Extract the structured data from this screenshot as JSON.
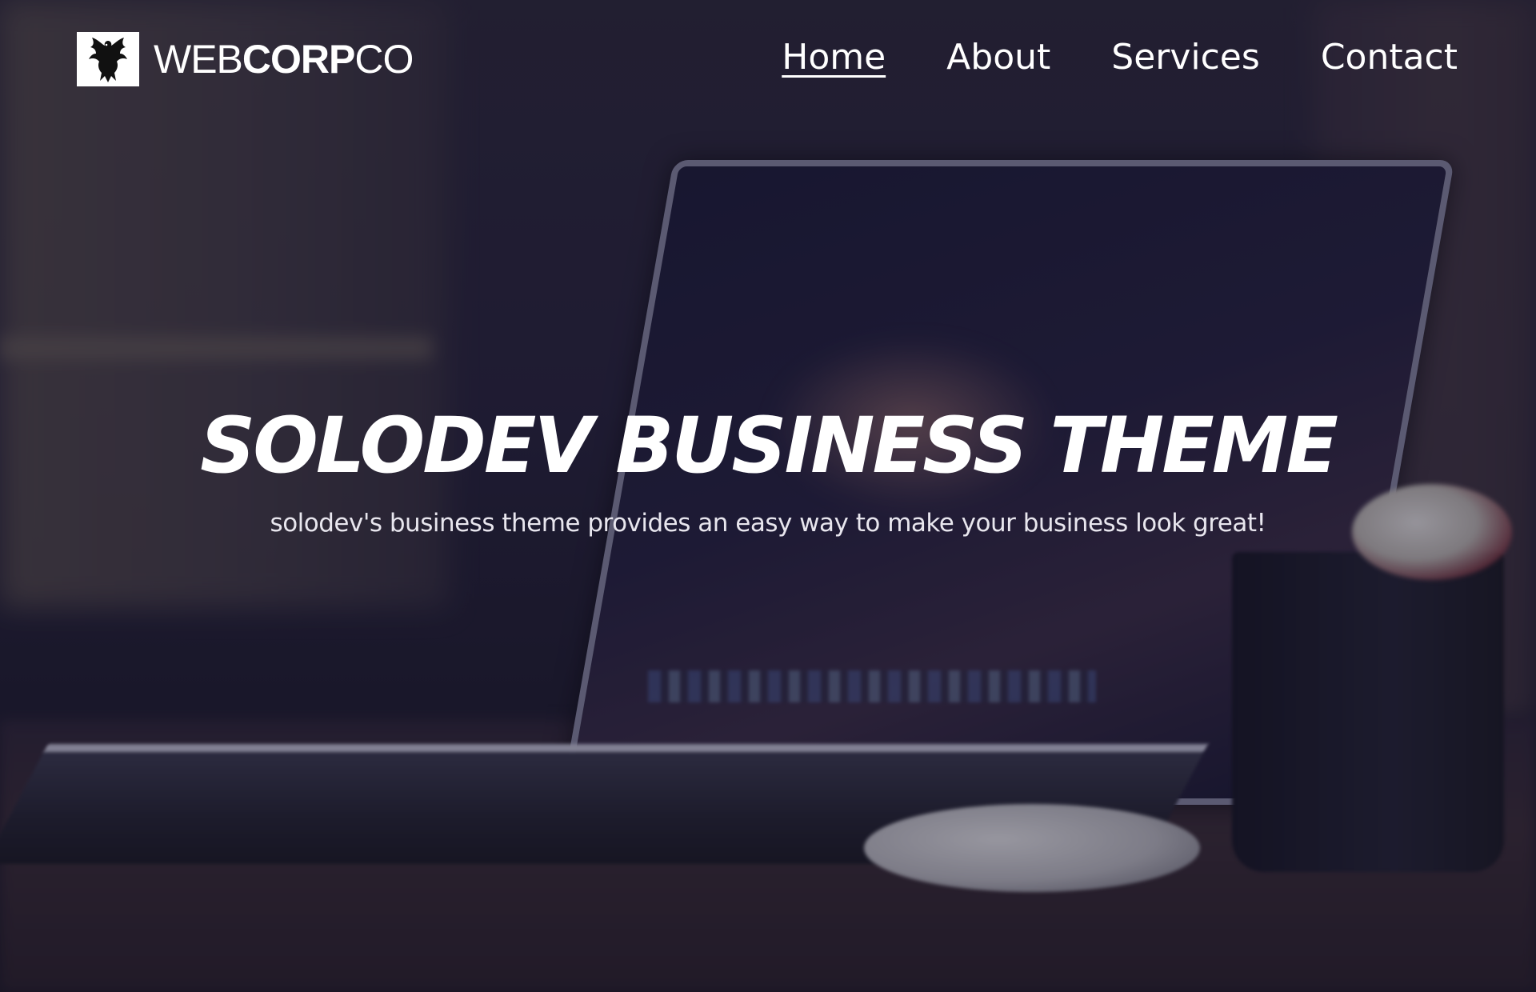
{
  "brand": {
    "name_prefix": "WEB",
    "name_bold": "CORP",
    "name_suffix": "CO",
    "logo_icon": "phoenix-icon"
  },
  "nav": {
    "items": [
      {
        "label": "Home",
        "active": true
      },
      {
        "label": "About",
        "active": false
      },
      {
        "label": "Services",
        "active": false
      },
      {
        "label": "Contact",
        "active": false
      }
    ]
  },
  "hero": {
    "title": "SOLODEV BUSINESS THEME",
    "subtitle": "solodev's business theme provides an easy way to make your business look great!"
  },
  "colors": {
    "text": "#ffffff",
    "overlay": "#161228"
  }
}
